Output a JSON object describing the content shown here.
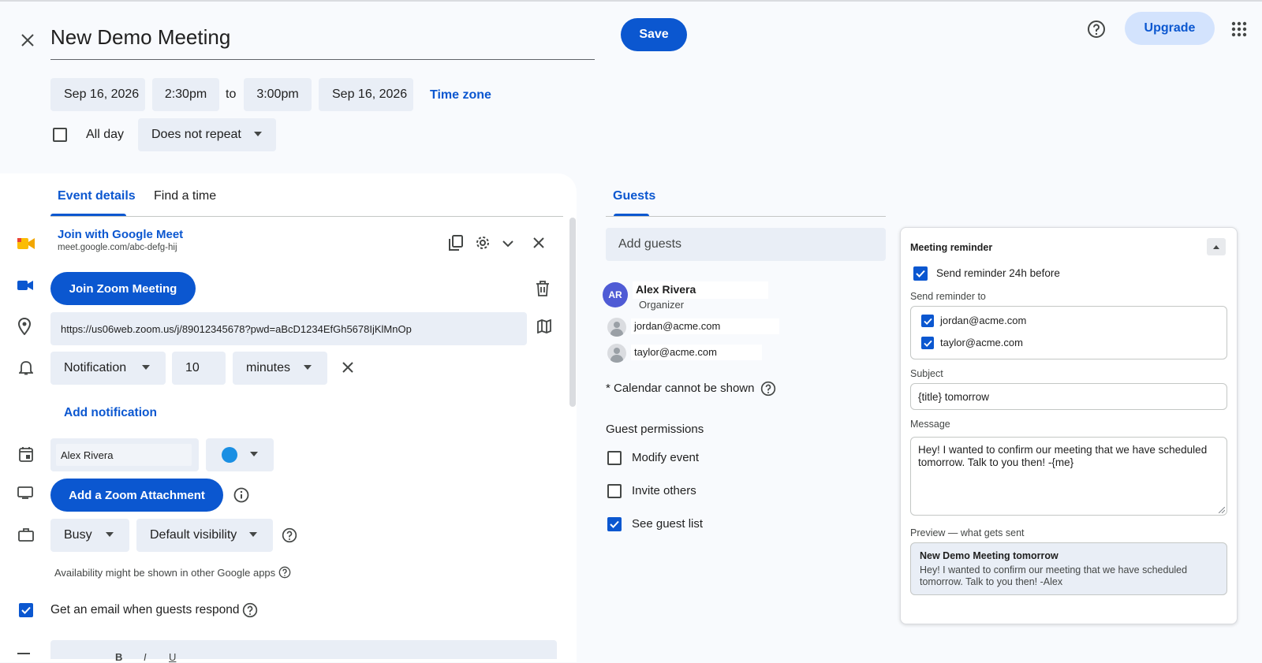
{
  "header": {
    "title": "New Demo Meeting",
    "save_label": "Save",
    "upgrade_label": "Upgrade"
  },
  "datetime": {
    "start_date": "Sep 16, 2026",
    "start_time": "2:30pm",
    "to_label": "to",
    "end_time": "3:00pm",
    "end_date": "Sep 16, 2026",
    "timezone_label": "Time zone",
    "all_day_label": "All day",
    "repeat_value": "Does not repeat"
  },
  "tabs": {
    "event_details": "Event details",
    "find_time": "Find a time",
    "guests": "Guests"
  },
  "meet": {
    "label": "Join with Google Meet",
    "url": "meet.google.com/abc-defg-hij"
  },
  "zoom": {
    "join_label": "Join Zoom Meeting",
    "url": "https://us06web.zoom.us/j/89012345678?pwd=aBcD1234EfGh5678IjKlMnOp",
    "attachment_label": "Add a Zoom Attachment"
  },
  "notification": {
    "type": "Notification",
    "amount": "10",
    "unit": "minutes",
    "add_label": "Add notification"
  },
  "calendar": {
    "owner": "Alex Rivera",
    "color": "#1a8fe3"
  },
  "availability": {
    "status": "Busy",
    "visibility": "Default visibility",
    "note": "Availability might be shown in other Google apps"
  },
  "email_guests_label": "Get an email when guests respond",
  "guests": {
    "add_placeholder": "Add guests",
    "list": [
      {
        "initials": "AR",
        "name": "Alex Rivera",
        "role": "Organizer"
      },
      {
        "email": "jordan@acme.com"
      },
      {
        "email": "taylor@acme.com"
      }
    ],
    "calendar_note": "* Calendar cannot be shown",
    "permissions_title": "Guest permissions",
    "permissions": [
      {
        "label": "Modify event",
        "checked": false
      },
      {
        "label": "Invite others",
        "checked": false
      },
      {
        "label": "See guest list",
        "checked": true
      }
    ]
  },
  "reminder": {
    "title": "Meeting reminder",
    "send_24h_label": "Send reminder 24h before",
    "send_to_label": "Send reminder to",
    "recipients": [
      "jordan@acme.com",
      "taylor@acme.com"
    ],
    "subject_label": "Subject",
    "subject_value": "{title} tomorrow",
    "message_label": "Message",
    "message_value": "Hey! I wanted to confirm our meeting that we have scheduled tomorrow. Talk to you then! -{me}",
    "preview_label": "Preview — what gets sent",
    "preview_subject": "New Demo Meeting tomorrow",
    "preview_body": "Hey! I wanted to confirm our meeting that we have scheduled tomorrow. Talk to you then! -Alex"
  }
}
